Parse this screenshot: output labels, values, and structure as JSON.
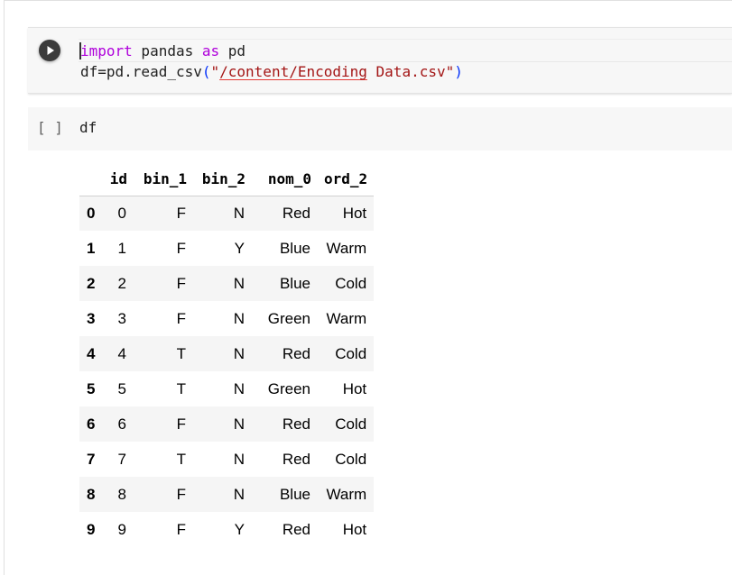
{
  "cell1": {
    "line1": {
      "kw_import": "import",
      "module": " pandas ",
      "kw_as": "as",
      "alias": " pd"
    },
    "line2": {
      "prefix": "df=pd.read_csv",
      "open_paren": "(",
      "quote_open": "\"",
      "path": "/content/Encoding",
      "rest": " Data.csv",
      "quote_close": "\"",
      "close_paren": ")"
    }
  },
  "cell2": {
    "exec_count": "[ ]",
    "code": "df"
  },
  "dataframe": {
    "columns": [
      "",
      "id",
      "bin_1",
      "bin_2",
      "nom_0",
      "ord_2"
    ],
    "rows": [
      {
        "index": "0",
        "id": "0",
        "bin_1": "F",
        "bin_2": "N",
        "nom_0": "Red",
        "ord_2": "Hot"
      },
      {
        "index": "1",
        "id": "1",
        "bin_1": "F",
        "bin_2": "Y",
        "nom_0": "Blue",
        "ord_2": "Warm"
      },
      {
        "index": "2",
        "id": "2",
        "bin_1": "F",
        "bin_2": "N",
        "nom_0": "Blue",
        "ord_2": "Cold"
      },
      {
        "index": "3",
        "id": "3",
        "bin_1": "F",
        "bin_2": "N",
        "nom_0": "Green",
        "ord_2": "Warm"
      },
      {
        "index": "4",
        "id": "4",
        "bin_1": "T",
        "bin_2": "N",
        "nom_0": "Red",
        "ord_2": "Cold"
      },
      {
        "index": "5",
        "id": "5",
        "bin_1": "T",
        "bin_2": "N",
        "nom_0": "Green",
        "ord_2": "Hot"
      },
      {
        "index": "6",
        "id": "6",
        "bin_1": "F",
        "bin_2": "N",
        "nom_0": "Red",
        "ord_2": "Cold"
      },
      {
        "index": "7",
        "id": "7",
        "bin_1": "T",
        "bin_2": "N",
        "nom_0": "Red",
        "ord_2": "Cold"
      },
      {
        "index": "8",
        "id": "8",
        "bin_1": "F",
        "bin_2": "N",
        "nom_0": "Blue",
        "ord_2": "Warm"
      },
      {
        "index": "9",
        "id": "9",
        "bin_1": "F",
        "bin_2": "Y",
        "nom_0": "Red",
        "ord_2": "Hot"
      }
    ]
  },
  "icons": {
    "run": "play-circle-icon"
  },
  "colors": {
    "keyword": "#af00db",
    "string": "#a31515",
    "paren": "#0431fa",
    "run_button": "#3c3c3c",
    "cell_background": "#f7f7f7",
    "row_stripe": "#f5f5f5"
  }
}
